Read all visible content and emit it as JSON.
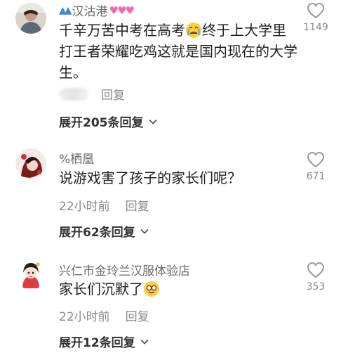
{
  "comments": [
    {
      "username": "汉沽港",
      "text_before": "千辛万苦中考在高考",
      "text_after": "终于上大学里打王者荣耀吃鸡这就是国内现在的大学生。",
      "time": "",
      "reply_label": "回复",
      "expand_label": "展开205条回复",
      "likes": "1149"
    },
    {
      "username": "%栖凰",
      "text": "说游戏害了孩子的家长们呢？",
      "time": "22小时前",
      "reply_label": "回复",
      "expand_label": "展开62条回复",
      "likes": "671"
    },
    {
      "username": "兴仁市金玲兰汉服体验店",
      "text": "家长们沉默了",
      "time": "22小时前",
      "reply_label": "回复",
      "expand_label": "展开12条回复",
      "likes": "353"
    }
  ],
  "icons": {
    "like": "heart-outline-icon",
    "expand": "chevron-down-icon",
    "emoji1": "crying-face-emoji-icon",
    "emoji2": "smiling-glasses-face-emoji-icon"
  }
}
